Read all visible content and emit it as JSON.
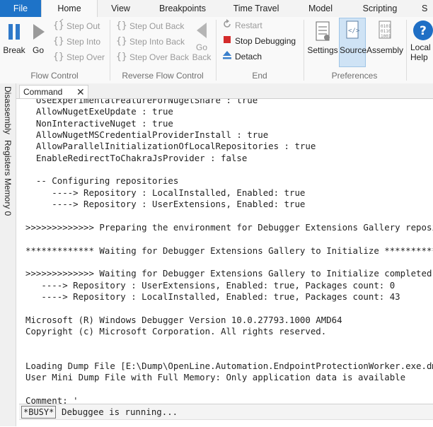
{
  "ribbon": {
    "tabs": [
      "File",
      "Home",
      "View",
      "Breakpoints",
      "Time Travel",
      "Model",
      "Scripting",
      "S"
    ],
    "active_tab": "Home",
    "flow_control": {
      "break": "Break",
      "go": "Go",
      "step_out": "Step Out",
      "step_into": "Step Into",
      "step_over": "Step Over",
      "label": "Flow Control"
    },
    "reverse_flow": {
      "step_out_back": "Step Out Back",
      "step_into_back": "Step Into Back",
      "step_over_back": "Step Over Back",
      "go_back_line1": "Go",
      "go_back_line2": "Back",
      "label": "Reverse Flow Control"
    },
    "end": {
      "restart": "Restart",
      "stop_debugging": "Stop Debugging",
      "detach": "Detach",
      "label": "End"
    },
    "preferences": {
      "settings": "Settings",
      "source": "Source",
      "assembly": "Assembly",
      "label": "Preferences"
    },
    "help": {
      "line1": "Local",
      "line2": "Help"
    }
  },
  "side_tabs": [
    "Disassembly",
    "Registers",
    "Memory 0"
  ],
  "command_window": {
    "tab_label": "Command",
    "lines": [
      "  UseExperimentalFeatureForNugetShare : true",
      "  AllowNugetExeUpdate : true",
      "  NonInteractiveNuget : true",
      "  AllowNugetMSCredentialProviderInstall : true",
      "  AllowParallelInitializationOfLocalRepositories : true",
      "  EnableRedirectToChakraJsProvider : false",
      "",
      "  -- Configuring repositories",
      "     ----> Repository : LocalInstalled, Enabled: true",
      "     ----> Repository : UserExtensions, Enabled: true",
      "",
      ">>>>>>>>>>>>> Preparing the environment for Debugger Extensions Gallery repositories completed",
      "",
      "************* Waiting for Debugger Extensions Gallery to Initialize **************",
      "",
      ">>>>>>>>>>>>> Waiting for Debugger Extensions Gallery to Initialize completed",
      "   ----> Repository : UserExtensions, Enabled: true, Packages count: 0",
      "   ----> Repository : LocalInstalled, Enabled: true, Packages count: 43",
      "",
      "Microsoft (R) Windows Debugger Version 10.0.27793.1000 AMD64",
      "Copyright (c) Microsoft Corporation. All rights reserved.",
      "",
      "",
      "Loading Dump File [E:\\Dump\\OpenLine.Automation.EndpointProtectionWorker.exe.dmp]",
      "User Mini Dump File with Full Memory: Only application data is available",
      "",
      "Comment: '"
    ],
    "status_badge": "*BUSY*",
    "status_text": "Debuggee is running..."
  },
  "colors": {
    "file_tab": "#1e73c8",
    "pause_icon": "#2f79c9",
    "stop_icon": "#d42b2b",
    "pressed_bg": "#cfe3f5"
  },
  "icons": [
    "pause-icon",
    "play-icon",
    "step-out-icon",
    "step-into-icon",
    "step-over-icon",
    "go-back-icon",
    "restart-icon",
    "stop-icon",
    "detach-icon",
    "settings-icon",
    "source-icon",
    "assembly-icon",
    "help-icon",
    "close-icon"
  ]
}
